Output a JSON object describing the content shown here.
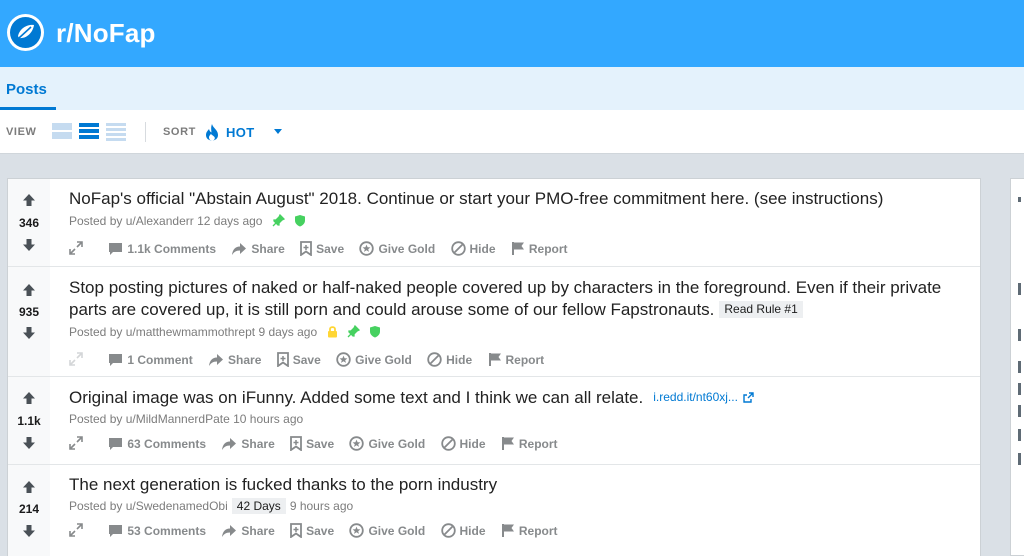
{
  "subreddit": {
    "name": "r/NoFap",
    "icon": "reddit-subreddit-logo"
  },
  "tabs": [
    {
      "label": "Posts",
      "active": true
    }
  ],
  "toolbar": {
    "view_label": "VIEW",
    "view_options": [
      "card-view-icon",
      "classic-view-icon",
      "compact-view-icon"
    ],
    "selected_view": "classic",
    "sort_label": "SORT",
    "sort_value": "HOT",
    "sort_icon": "flame-icon"
  },
  "colors": {
    "banner": "#33a8ff",
    "accent": "#0079d3",
    "tab_bar": "#e4f2fc",
    "page_bg": "#dae0e6",
    "pin": "#46d160",
    "mod_shield": "#46d160",
    "lock": "#ffd635"
  },
  "posts": [
    {
      "score": "346",
      "title": "NoFap's official \"Abstain August\" 2018. Continue or start your PMO-free commitment here. (see instructions)",
      "author": "u/Alexanderr",
      "time": "12 days ago",
      "flags": [
        "pin-icon",
        "mod-shield-icon"
      ],
      "comments": "1.1k Comments",
      "share": "Share",
      "save": "Save",
      "gold": "Give Gold",
      "hide": "Hide",
      "report": "Report"
    },
    {
      "score": "935",
      "title": "Stop posting pictures of naked or half-naked people covered up by characters in the foreground. Even if their private parts are covered up, it is still porn and could arouse some of our fellow Fapstronauts.",
      "flair": "Read Rule #1",
      "author": "u/matthewmammothrept",
      "time": "9 days ago",
      "flags": [
        "lock-icon",
        "pin-icon",
        "mod-shield-icon"
      ],
      "comments": "1 Comment",
      "share": "Share",
      "save": "Save",
      "gold": "Give Gold",
      "hide": "Hide",
      "report": "Report"
    },
    {
      "score": "1.1k",
      "title": "Original image was on iFunny. Added some text and I think we can all relate.",
      "domain": "i.redd.it/nt60xj...",
      "author": "u/MildMannerdPate",
      "time": "10 hours ago",
      "comments": "63 Comments",
      "share": "Share",
      "save": "Save",
      "gold": "Give Gold",
      "hide": "Hide",
      "report": "Report"
    },
    {
      "score": "214",
      "title": "The next generation is fucked thanks to the porn industry",
      "author": "u/SwedenamedObi",
      "author_flair": "42 Days",
      "time": "9 hours ago",
      "comments": "53 Comments",
      "share": "Share",
      "save": "Save",
      "gold": "Give Gold",
      "hide": "Hide",
      "report": "Report"
    }
  ]
}
